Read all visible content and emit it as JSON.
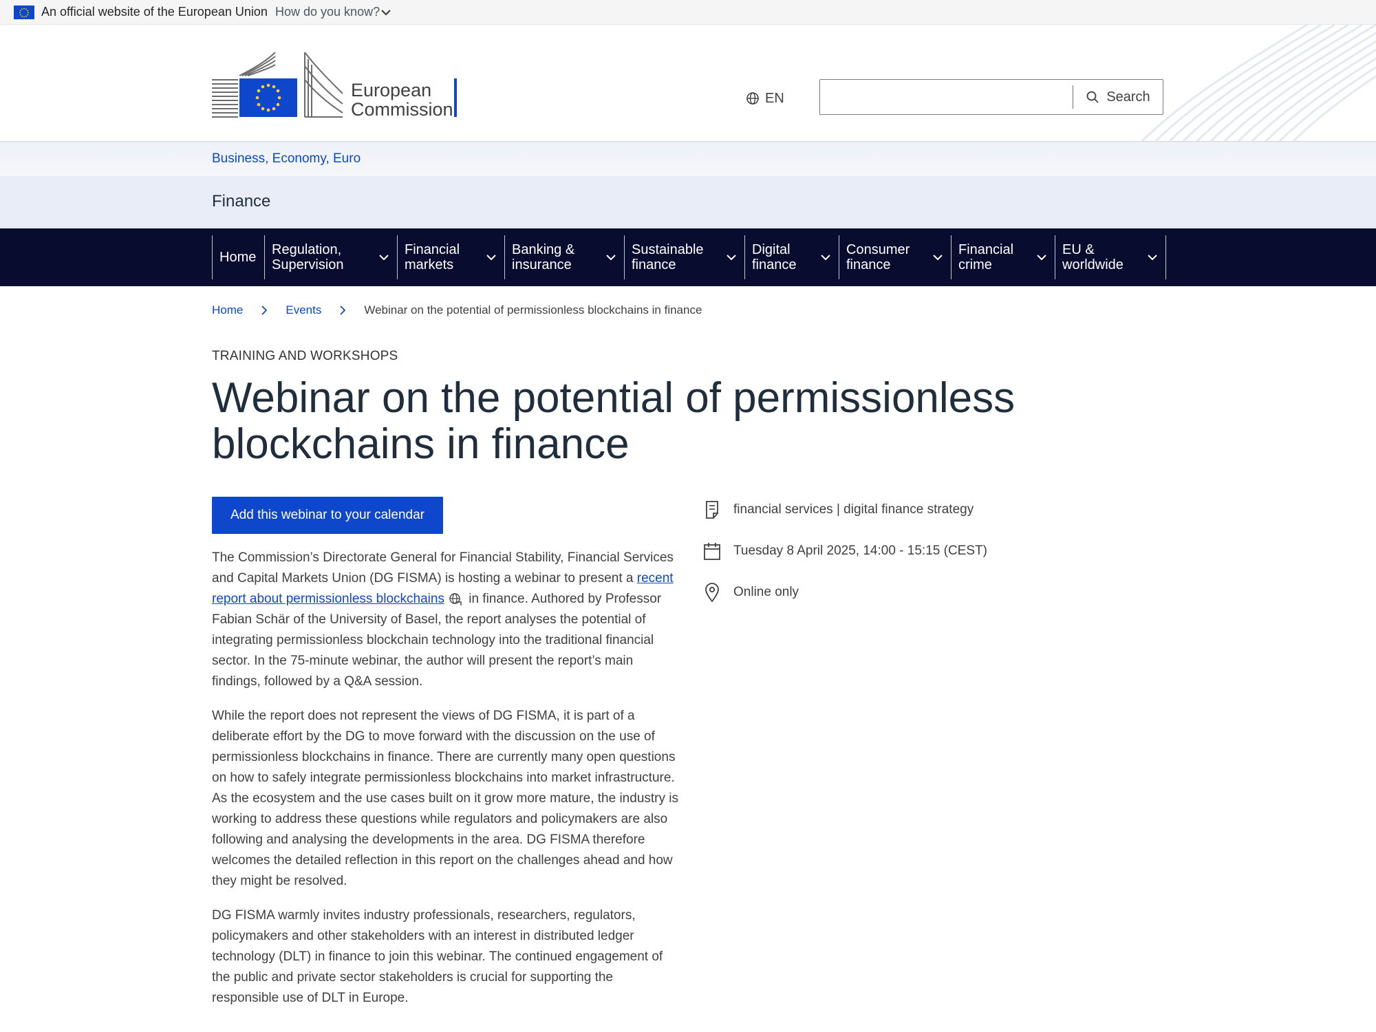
{
  "eu_bar": {
    "official_text": "An official website of the European Union",
    "how_know_text": "How do you know?"
  },
  "header": {
    "logo_line1": "European",
    "logo_line2": "Commission",
    "language": "EN",
    "search_placeholder": "",
    "search_label": "Search"
  },
  "site_name": "Business, Economy, Euro",
  "page_group": "Finance",
  "nav": {
    "items": [
      {
        "label": "Home"
      },
      {
        "label": "Regulation,\nSupervision"
      },
      {
        "label": "Financial\nmarkets"
      },
      {
        "label": "Banking &\ninsurance"
      },
      {
        "label": "Sustainable\nfinance"
      },
      {
        "label": "Digital\nfinance"
      },
      {
        "label": "Consumer\nfinance"
      },
      {
        "label": "Financial\ncrime"
      },
      {
        "label": "EU &\nworldwide"
      }
    ]
  },
  "breadcrumb": {
    "home": "Home",
    "events": "Events",
    "current": "Webinar on the potential of permissionless blockchains in finance"
  },
  "content": {
    "eyebrow": "TRAINING AND WORKSHOPS",
    "title": "Webinar on the potential of permissionless blockchains in finance",
    "calendar_button": "Add this webinar to your calendar",
    "p1_before": "The Commission’s Directorate General for Financial Stability, Financial Services and Capital Markets Union (DG FISMA) is hosting a webinar to present a ",
    "p1_link": "recent report about permissionless blockchains",
    "p1_after": " in finance. Authored by Professor Fabian Schär of the University of Basel, the report analyses the potential of integrating permissionless blockchain technology into the traditional financial sector. In the 75-minute webinar, the author will present the report’s main findings, followed by a Q&A session.",
    "p2": "While the report does not represent the views of DG FISMA, it is part of a deliberate effort by the DG to move forward with the discussion on the use of permissionless blockchains in finance. There are currently many open questions on how to safely integrate permissionless blockchains into market infrastructure. As the ecosystem and the use cases built on it grow more mature, the industry is working to address these questions while regulators and policymakers are also following and analysing the developments in the area. DG FISMA therefore welcomes the detailed reflection in this report on the challenges ahead and how they might be resolved.",
    "p3": "DG FISMA warmly invites industry professionals, researchers, regulators, policymakers and other stakeholders with an interest in distributed ledger technology (DLT) in finance to join this webinar. The continued engagement of the public and private sector stakeholders is crucial for supporting the responsible use of DLT in Europe."
  },
  "meta": {
    "topics": "financial services | digital finance strategy",
    "date": "Tuesday 8 April 2025, 14:00 - 15:15 (CEST)",
    "location": "Online only"
  },
  "colors": {
    "primary_blue": "#0e47cb",
    "nav_background": "#080c2f",
    "title_color": "#1f2d3d"
  }
}
